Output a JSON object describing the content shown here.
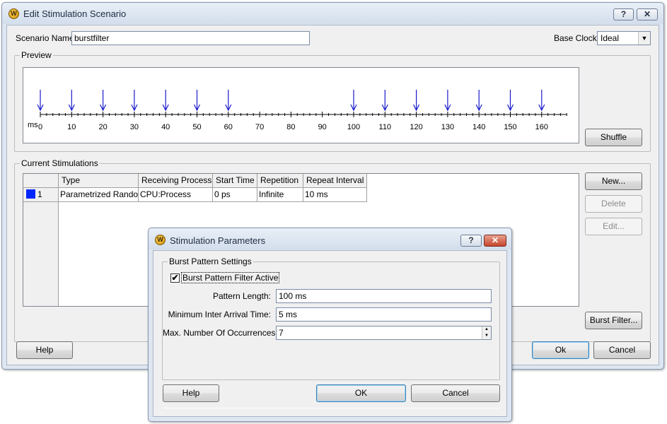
{
  "main": {
    "title": "Edit Stimulation Scenario",
    "help_btn": "?",
    "close_btn": "✕",
    "scenario_name_label": "Scenario Name",
    "scenario_name_value": "burstfilter",
    "base_clock_label": "Base Clock",
    "base_clock_value": "Ideal",
    "preview_label": "Preview",
    "shuffle_label": "Shuffle",
    "current_stimulations_label": "Current Stimulations",
    "new_label": "New...",
    "delete_label": "Delete",
    "edit_label": "Edit...",
    "burst_filter_label": "Burst Filter...",
    "help_label": "Help",
    "ok_label": "Ok",
    "cancel_label": "Cancel"
  },
  "timeline": {
    "unit": "ms",
    "tick_labels": [
      "0",
      "10",
      "20",
      "30",
      "40",
      "50",
      "60",
      "70",
      "80",
      "90",
      "100",
      "110",
      "120",
      "130",
      "140",
      "150",
      "160"
    ],
    "events": [
      0,
      10,
      20,
      30,
      40,
      50,
      60,
      100,
      110,
      120,
      130,
      140,
      150,
      160
    ],
    "max": 168,
    "arrow_color": "#1a1acc"
  },
  "table": {
    "columns": [
      "Type",
      "Receiving Process",
      "Start Time",
      "Repetition",
      "Repeat Interval"
    ],
    "rows": [
      {
        "index": "1",
        "color": "#0026ff",
        "cells": [
          "Parametrized Random",
          "CPU:Process",
          "0 ps",
          "Infinite",
          "10 ms"
        ]
      }
    ]
  },
  "dialog": {
    "title": "Stimulation Parameters",
    "help_btn": "?",
    "close_btn": "✕",
    "group_label": "Burst Pattern Settings",
    "checkbox_label": "Burst Pattern Filter Active",
    "checkbox_checked": "✔",
    "pattern_length_label": "Pattern Length:",
    "pattern_length_value": "100 ms",
    "min_inter_arrival_label": "Minimum Inter Arrival Time:",
    "min_inter_arrival_value": "5 ms",
    "max_occurrences_label": "Max. Number Of Occurrences:",
    "max_occurrences_value": "7",
    "help_label": "Help",
    "ok_label": "OK",
    "cancel_label": "Cancel"
  }
}
